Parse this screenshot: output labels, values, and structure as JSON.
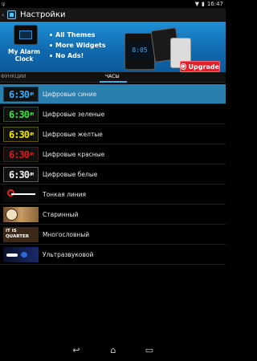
{
  "status_bar": {
    "time": "16:47",
    "left_icon": "trident-icon"
  },
  "action_bar": {
    "title": "Настройки"
  },
  "banner": {
    "brand_line1": "My Alarm",
    "brand_line2": "Clock",
    "features": [
      "All Themes",
      "More Widgets",
      "No Ads!"
    ],
    "device_time": "8:05",
    "upgrade_label": "Upgrade"
  },
  "tabs": {
    "left": "ФУНКЦИИ",
    "right": "ЧАСЫ",
    "active": "right"
  },
  "themes": [
    {
      "label": "Цифровые синие",
      "kind": "digital",
      "color": "#3fa9f5",
      "selected": true
    },
    {
      "label": "Цифровые зеленые",
      "kind": "digital",
      "color": "#3be03b",
      "selected": false
    },
    {
      "label": "Цифровые желтые",
      "kind": "digital",
      "color": "#f2e600",
      "selected": false
    },
    {
      "label": "Цифровые красные",
      "kind": "digital",
      "color": "#e01a1a",
      "selected": false
    },
    {
      "label": "Цифровые белые",
      "kind": "digital",
      "color": "#f0f0f0",
      "selected": false
    },
    {
      "label": "Тонкая линия",
      "kind": "line",
      "selected": false
    },
    {
      "label": "Старинный",
      "kind": "vintage",
      "selected": false
    },
    {
      "label": "Многословный",
      "kind": "words",
      "selected": false
    },
    {
      "label": "Ультразвуковой",
      "kind": "ultra",
      "selected": false
    }
  ],
  "clock_text": {
    "time": "6:30",
    "suffix": "AM"
  },
  "words_clock": {
    "line1": "IT  IS",
    "line2": "QUARTER"
  },
  "colors": {
    "accent": "#33b5e5",
    "selected_row": "#2a7fae",
    "banner": "#1877c0",
    "upgrade": "#e0202a"
  }
}
